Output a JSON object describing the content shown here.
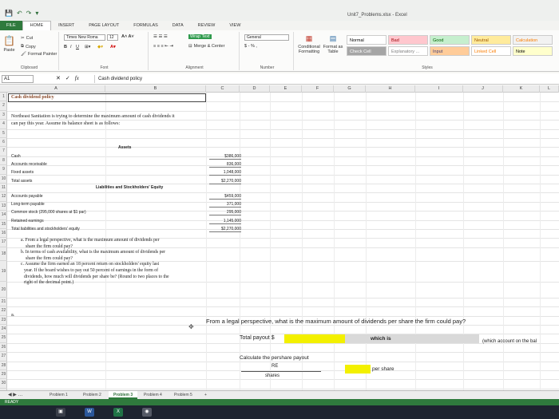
{
  "window": {
    "title": "Unit7_Problems.xlsx - Excel",
    "quick_access": [
      "💾",
      "↶",
      "↷",
      "▾"
    ]
  },
  "ribbon": {
    "tabs": [
      "File",
      "Home",
      "Insert",
      "Page Layout",
      "Formulas",
      "Data",
      "Review",
      "View"
    ],
    "active_tab": "Home",
    "clipboard": {
      "paste": "Paste",
      "cut": "Cut",
      "copy": "Copy",
      "format_painter": "Format Painter",
      "label": "Clipboard"
    },
    "font": {
      "name": "Times New Roma",
      "size": "12",
      "label": "Font"
    },
    "alignment": {
      "wrap": "Wrap Text",
      "merge": "Merge & Center",
      "label": "Alignment"
    },
    "number": {
      "format": "General",
      "label": "Number",
      "symbols": "$ - % ,"
    },
    "styles": {
      "conditional": "Conditional Formatting",
      "format_as_table": "Format as Table",
      "cells": [
        {
          "label": "Normal",
          "bg": "#ffffff",
          "fg": "#000000"
        },
        {
          "label": "Bad",
          "bg": "#ffc7ce",
          "fg": "#9c0006"
        },
        {
          "label": "Good",
          "bg": "#c6efce",
          "fg": "#006100"
        },
        {
          "label": "Neutral",
          "bg": "#ffeb9c",
          "fg": "#9c5700"
        },
        {
          "label": "Calculation",
          "bg": "#f2f2f2",
          "fg": "#fa7d00"
        },
        {
          "label": "Check Cell",
          "bg": "#a5a5a5",
          "fg": "#ffffff"
        },
        {
          "label": "Explanatory ...",
          "bg": "#ffffff",
          "fg": "#7f7f7f"
        },
        {
          "label": "Input",
          "bg": "#ffcc99",
          "fg": "#3f3f76"
        },
        {
          "label": "Linked Cell",
          "bg": "#ffffff",
          "fg": "#fa7d00"
        },
        {
          "label": "Note",
          "bg": "#ffffcc",
          "fg": "#000000"
        }
      ],
      "label": "Styles"
    }
  },
  "formula_bar": {
    "name_box": "A1",
    "content": "Cash dividend policy"
  },
  "grid": {
    "columns": [
      "A",
      "B",
      "C",
      "D",
      "E",
      "F",
      "G",
      "H",
      "I",
      "J",
      "K",
      "L"
    ],
    "rows": [
      "1",
      "2",
      "3",
      "4",
      "5",
      "6",
      "7",
      "8",
      "9",
      "10",
      "11",
      "12",
      "13",
      "14",
      "15",
      "16",
      "17",
      "18",
      "19",
      "20",
      "21",
      "22",
      "23",
      "24",
      "25",
      "26",
      "27",
      "28",
      "29",
      "30"
    ]
  },
  "sheet": {
    "title": "Cash dividend policy",
    "intro_line1": "Northeast Sanitation is trying to determine the maximum amount of cash dividends it",
    "intro_line2": "can pay this year. Assume its balance sheet is as follows:",
    "assets_header": "Assets",
    "assets": [
      {
        "label": "Cash",
        "value": "$386,000"
      },
      {
        "label": "Accounts receivable",
        "value": "836,000"
      },
      {
        "label": "Fixed assets",
        "value": "1,048,000"
      },
      {
        "label": "Total assets",
        "value": "$2,270,000"
      }
    ],
    "liab_header": "Liabilities and Stockholders' Equity",
    "liabilities": [
      {
        "label": "Accounts payable",
        "value": "$459,000"
      },
      {
        "label": "Long-term payable",
        "value": "371,000"
      },
      {
        "label": "Common stock (295,000 shares at $1 par)",
        "value": "295,000"
      },
      {
        "label": "Retained earnings",
        "value": "1,145,000"
      },
      {
        "label": "Total liabilities and stockholders' equity",
        "value": "$2,270,000"
      }
    ],
    "question_lines": [
      "a. From a legal perspective, what is the maximum amount of dividends per",
      "share the firm could pay?",
      "b. In terms of cash availability, what is the maximum amount of dividends per",
      "share the firm could pay?",
      "c. Assume the firm earned an 18 percent return on stockholders' equity last",
      "year. If the board wishes to pay out 50 percent of earnings in the form of",
      "dividends, how much will dividends per share be? (Round to two places to the",
      "right of the decimal point.)"
    ],
    "part_a_marker": "a.",
    "part_a_question": "From a legal perspective, what is the maximum amount of dividends per share the firm could pay?",
    "total_payout_label": "Total payout $",
    "which_is_label": "which is",
    "which_account_label": "(which account on the bal",
    "calc_label": "Calculate the pershare payout",
    "re_label": "RE",
    "shares_label": "shares",
    "per_share_label": "per share"
  },
  "sheet_tabs": [
    "Problem 1",
    "Problem 2",
    "Problem 3",
    "Problem 4",
    "Problem 5",
    "+"
  ],
  "active_sheet": "Problem 3",
  "status": {
    "mode": "READY"
  },
  "taskbar": [
    {
      "icon": "file-explorer-icon",
      "glyph": "▣",
      "color": "#3a3f4a"
    },
    {
      "icon": "word-icon",
      "glyph": "W",
      "color": "#2b579a"
    },
    {
      "icon": "excel-icon",
      "glyph": "X",
      "color": "#217346"
    },
    {
      "icon": "app-icon",
      "glyph": "◉",
      "color": "#555a66"
    }
  ]
}
